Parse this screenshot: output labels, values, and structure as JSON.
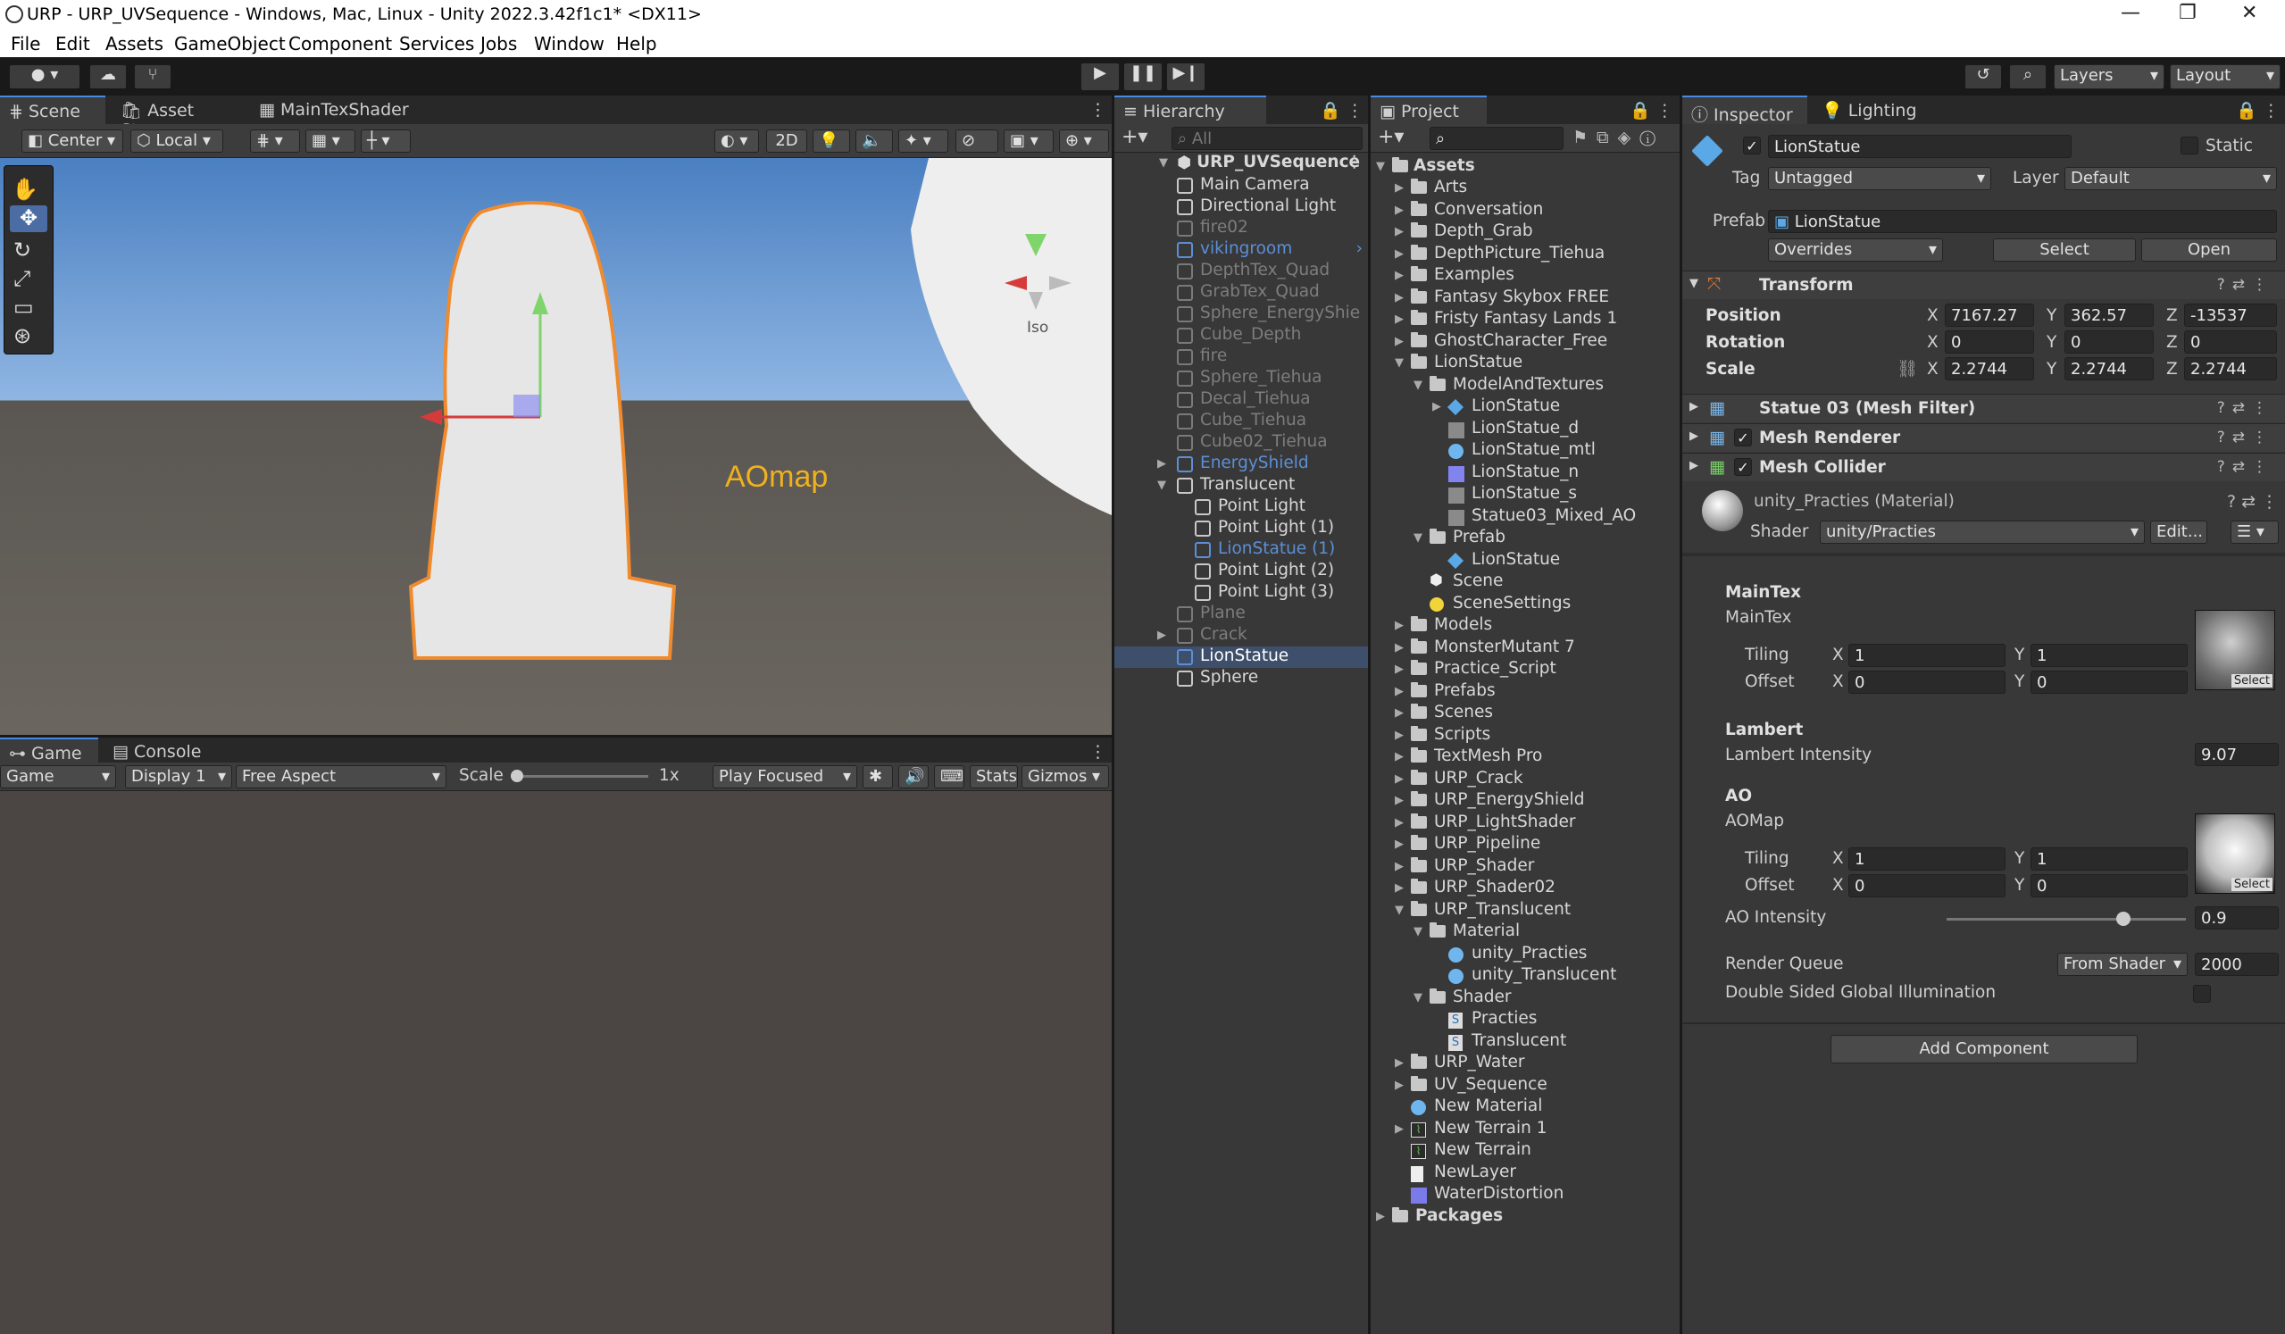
{
  "window": {
    "title": "URP - URP_UVSequence - Windows, Mac, Linux - Unity 2022.3.42f1c1* <DX11>",
    "controls": [
      "—",
      "❐",
      "✕"
    ]
  },
  "menu": [
    "File",
    "Edit",
    "Assets",
    "GameObject",
    "Component",
    "Services",
    "Jobs",
    "Window",
    "Help"
  ],
  "toolbar": {
    "layers": "Layers",
    "layout": "Layout"
  },
  "scene_panel": {
    "tabs": [
      "Scene",
      "Asset Store",
      "MainTexShader"
    ],
    "pivot": "Center",
    "space": "Local",
    "mode_2d": "2D",
    "iso": "Iso",
    "overlay_text": "AOmap"
  },
  "game_panel": {
    "tabs": [
      "Game",
      "Console"
    ],
    "game_dd": "Game",
    "display": "Display 1",
    "aspect": "Free Aspect",
    "scale_label": "Scale",
    "scale_value": "1x",
    "play_mode": "Play Focused",
    "stats": "Stats",
    "gizmos": "Gizmos"
  },
  "hierarchy": {
    "title": "Hierarchy",
    "search": "All",
    "root": "URP_UVSequence",
    "items": [
      {
        "label": "Main Camera",
        "depth": 1,
        "state": "normal",
        "arrow": ""
      },
      {
        "label": "Directional Light",
        "depth": 1,
        "state": "normal",
        "arrow": ""
      },
      {
        "label": "fire02",
        "depth": 1,
        "state": "dim",
        "arrow": ""
      },
      {
        "label": "vikingroom",
        "depth": 1,
        "state": "blue",
        "arrow": ""
      },
      {
        "label": "DepthTex_Quad",
        "depth": 1,
        "state": "dim",
        "arrow": ""
      },
      {
        "label": "GrabTex_Quad",
        "depth": 1,
        "state": "dim",
        "arrow": ""
      },
      {
        "label": "Sphere_EnergyShie",
        "depth": 1,
        "state": "dim",
        "arrow": ""
      },
      {
        "label": "Cube_Depth",
        "depth": 1,
        "state": "dim",
        "arrow": ""
      },
      {
        "label": "fire",
        "depth": 1,
        "state": "dim",
        "arrow": ""
      },
      {
        "label": "Sphere_Tiehua",
        "depth": 1,
        "state": "dim",
        "arrow": ""
      },
      {
        "label": "Decal_Tiehua",
        "depth": 1,
        "state": "dim",
        "arrow": ""
      },
      {
        "label": "Cube_Tiehua",
        "depth": 1,
        "state": "dim",
        "arrow": ""
      },
      {
        "label": "Cube02_Tiehua",
        "depth": 1,
        "state": "dim",
        "arrow": ""
      },
      {
        "label": "EnergyShield",
        "depth": 1,
        "state": "blue",
        "arrow": "▶"
      },
      {
        "label": "Translucent",
        "depth": 1,
        "state": "normal",
        "arrow": "▼"
      },
      {
        "label": "Point Light",
        "depth": 2,
        "state": "normal",
        "arrow": ""
      },
      {
        "label": "Point Light (1)",
        "depth": 2,
        "state": "normal",
        "arrow": ""
      },
      {
        "label": "LionStatue (1)",
        "depth": 2,
        "state": "blue",
        "arrow": ""
      },
      {
        "label": "Point Light (2)",
        "depth": 2,
        "state": "normal",
        "arrow": ""
      },
      {
        "label": "Point Light (3)",
        "depth": 2,
        "state": "normal",
        "arrow": ""
      },
      {
        "label": "Plane",
        "depth": 1,
        "state": "dim",
        "arrow": ""
      },
      {
        "label": "Crack",
        "depth": 1,
        "state": "dim",
        "arrow": "▶"
      },
      {
        "label": "LionStatue",
        "depth": 1,
        "state": "selected",
        "arrow": ""
      },
      {
        "label": "Sphere",
        "depth": 1,
        "state": "normal",
        "arrow": ""
      }
    ]
  },
  "project": {
    "title": "Project",
    "root": "Assets",
    "items": [
      {
        "label": "Arts",
        "depth": 1,
        "type": "folder",
        "arrow": "▶"
      },
      {
        "label": "Conversation",
        "depth": 1,
        "type": "folder",
        "arrow": "▶"
      },
      {
        "label": "Depth_Grab",
        "depth": 1,
        "type": "folder",
        "arrow": "▶"
      },
      {
        "label": "DepthPicture_Tiehua",
        "depth": 1,
        "type": "folder",
        "arrow": "▶"
      },
      {
        "label": "Examples",
        "depth": 1,
        "type": "folder",
        "arrow": "▶"
      },
      {
        "label": "Fantasy Skybox FREE",
        "depth": 1,
        "type": "folder",
        "arrow": "▶"
      },
      {
        "label": "Fristy Fantasy Lands 1",
        "depth": 1,
        "type": "folder",
        "arrow": "▶"
      },
      {
        "label": "GhostCharacter_Free",
        "depth": 1,
        "type": "folder",
        "arrow": "▶"
      },
      {
        "label": "LionStatue",
        "depth": 1,
        "type": "folder",
        "arrow": "▼"
      },
      {
        "label": "ModelAndTextures",
        "depth": 2,
        "type": "folder",
        "arrow": "▼"
      },
      {
        "label": "LionStatue",
        "depth": 3,
        "type": "prefab",
        "arrow": "▶"
      },
      {
        "label": "LionStatue_d",
        "depth": 3,
        "type": "texture",
        "arrow": ""
      },
      {
        "label": "LionStatue_mtl",
        "depth": 3,
        "type": "material",
        "arrow": ""
      },
      {
        "label": "LionStatue_n",
        "depth": 3,
        "type": "normal",
        "arrow": ""
      },
      {
        "label": "LionStatue_s",
        "depth": 3,
        "type": "texture",
        "arrow": ""
      },
      {
        "label": "Statue03_Mixed_AO",
        "depth": 3,
        "type": "texture",
        "arrow": ""
      },
      {
        "label": "Prefab",
        "depth": 2,
        "type": "folder",
        "arrow": "▼"
      },
      {
        "label": "LionStatue",
        "depth": 3,
        "type": "prefab",
        "arrow": ""
      },
      {
        "label": "Scene",
        "depth": 2,
        "type": "scene",
        "arrow": ""
      },
      {
        "label": "SceneSettings",
        "depth": 2,
        "type": "light",
        "arrow": ""
      },
      {
        "label": "Models",
        "depth": 1,
        "type": "folder",
        "arrow": "▶"
      },
      {
        "label": "MonsterMutant 7",
        "depth": 1,
        "type": "folder",
        "arrow": "▶"
      },
      {
        "label": "Practice_Script",
        "depth": 1,
        "type": "folder",
        "arrow": "▶"
      },
      {
        "label": "Prefabs",
        "depth": 1,
        "type": "folder",
        "arrow": "▶"
      },
      {
        "label": "Scenes",
        "depth": 1,
        "type": "folder",
        "arrow": "▶"
      },
      {
        "label": "Scripts",
        "depth": 1,
        "type": "folder",
        "arrow": "▶"
      },
      {
        "label": "TextMesh Pro",
        "depth": 1,
        "type": "folder",
        "arrow": "▶"
      },
      {
        "label": "URP_Crack",
        "depth": 1,
        "type": "folder",
        "arrow": "▶"
      },
      {
        "label": "URP_EnergyShield",
        "depth": 1,
        "type": "folder",
        "arrow": "▶"
      },
      {
        "label": "URP_LightShader",
        "depth": 1,
        "type": "folder",
        "arrow": "▶"
      },
      {
        "label": "URP_Pipeline",
        "depth": 1,
        "type": "folder",
        "arrow": "▶"
      },
      {
        "label": "URP_Shader",
        "depth": 1,
        "type": "folder",
        "arrow": "▶"
      },
      {
        "label": "URP_Shader02",
        "depth": 1,
        "type": "folder",
        "arrow": "▶"
      },
      {
        "label": "URP_Translucent",
        "depth": 1,
        "type": "folder",
        "arrow": "▼"
      },
      {
        "label": "Material",
        "depth": 2,
        "type": "folder",
        "arrow": "▼"
      },
      {
        "label": "unity_Practies",
        "depth": 3,
        "type": "material",
        "arrow": ""
      },
      {
        "label": "unity_Translucent",
        "depth": 3,
        "type": "material",
        "arrow": ""
      },
      {
        "label": "Shader",
        "depth": 2,
        "type": "folder",
        "arrow": "▼"
      },
      {
        "label": "Practies",
        "depth": 3,
        "type": "shader",
        "arrow": ""
      },
      {
        "label": "Translucent",
        "depth": 3,
        "type": "shader",
        "arrow": ""
      },
      {
        "label": "URP_Water",
        "depth": 1,
        "type": "folder",
        "arrow": "▶"
      },
      {
        "label": "UV_Sequence",
        "depth": 1,
        "type": "folder",
        "arrow": "▶"
      },
      {
        "label": "New Material",
        "depth": 1,
        "type": "material",
        "arrow": ""
      },
      {
        "label": "New Terrain 1",
        "depth": 1,
        "type": "terrain",
        "arrow": "▶"
      },
      {
        "label": "New Terrain",
        "depth": 1,
        "type": "terrain",
        "arrow": ""
      },
      {
        "label": "NewLayer",
        "depth": 1,
        "type": "file",
        "arrow": ""
      },
      {
        "label": "WaterDistortion",
        "depth": 1,
        "type": "rendertex",
        "arrow": ""
      },
      {
        "label": "Packages",
        "depth": 0,
        "type": "folder",
        "arrow": "▶"
      }
    ]
  },
  "inspector": {
    "tabs": [
      "Inspector",
      "Lighting"
    ],
    "object_name": "LionStatue",
    "static": "Static",
    "tag_label": "Tag",
    "tag": "Untagged",
    "layer_label": "Layer",
    "layer": "Default",
    "prefab_label": "Prefab",
    "prefab": "LionStatue",
    "overrides": "Overrides",
    "select": "Select",
    "open": "Open",
    "transform": {
      "title": "Transform",
      "position": {
        "label": "Position",
        "x": "7167.27",
        "y": "362.57",
        "z": "-13537"
      },
      "rotation": {
        "label": "Rotation",
        "x": "0",
        "y": "0",
        "z": "0"
      },
      "scale": {
        "label": "Scale",
        "x": "2.2744",
        "y": "2.2744",
        "z": "2.2744"
      }
    },
    "mesh_filter": "Statue 03 (Mesh Filter)",
    "mesh_renderer": "Mesh Renderer",
    "mesh_collider": "Mesh Collider",
    "material": {
      "name": "unity_Practies (Material)",
      "shader_label": "Shader",
      "shader": "unity/Practies",
      "edit": "Edit..."
    },
    "maintex": {
      "header": "MainTex",
      "label": "MainTex",
      "tiling": "Tiling",
      "offset": "Offset",
      "tx": "1",
      "ty": "1",
      "ox": "0",
      "oy": "0"
    },
    "lambert": {
      "header": "Lambert",
      "label": "Lambert Intensity",
      "value": "9.07"
    },
    "ao": {
      "header": "AO",
      "label": "AOMap",
      "tiling": "Tiling",
      "offset": "Offset",
      "tx": "1",
      "ty": "1",
      "ox": "0",
      "oy": "0",
      "intensity_label": "AO Intensity",
      "intensity": "0.9"
    },
    "render_queue": {
      "label": "Render Queue",
      "mode": "From Shader",
      "value": "2000"
    },
    "dsgi": "Double Sided Global Illumination",
    "add_component": "Add Component",
    "select_small": "Select",
    "axis": {
      "x": "X",
      "y": "Y",
      "z": "Z"
    }
  }
}
